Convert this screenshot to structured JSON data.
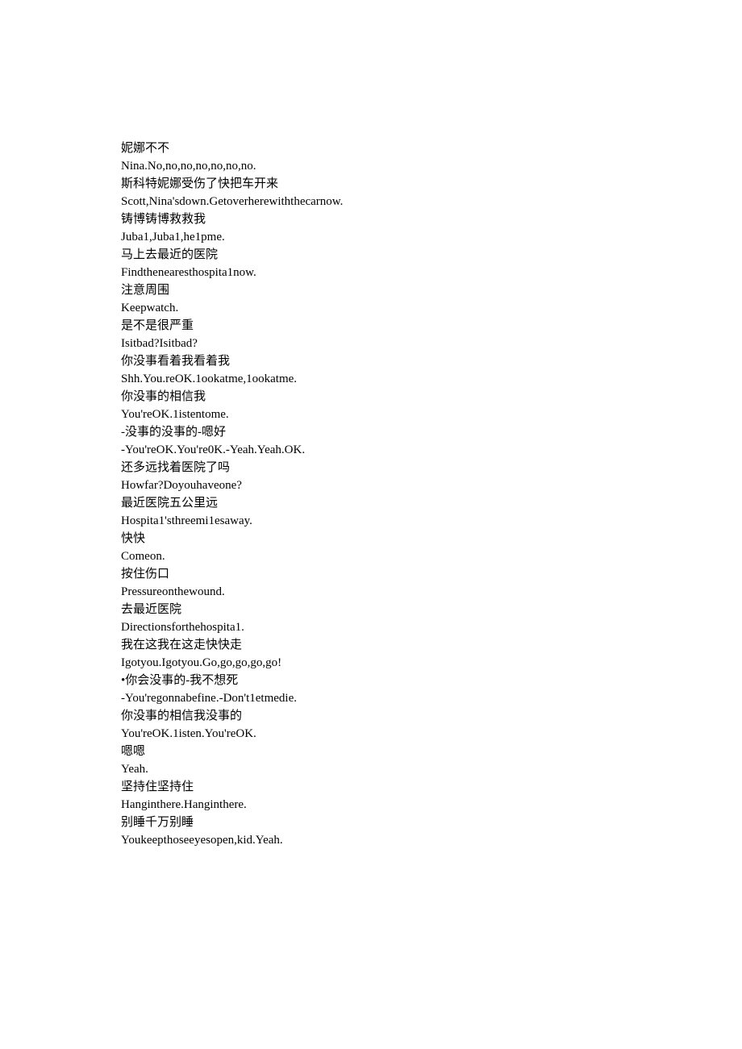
{
  "lines": [
    "妮娜不不",
    "Nina.No,no,no,no,no,no,no.",
    "斯科特妮娜受伤了快把车开来",
    "Scott,Nina'sdown.Getoverherewiththecarnow.",
    "铸博铸博救救我",
    "Juba1,Juba1,he1pme.",
    "马上去最近的医院",
    "Findthenearesthospita1now.",
    "注意周围",
    "Keepwatch.",
    "是不是很严重",
    "Isitbad?Isitbad?",
    "你没事看着我看着我",
    "Shh.You.reOK.1ookatme,1ookatme.",
    "你没事的相信我",
    "You'reOK.1istentome.",
    "-没事的没事的-嗯好",
    "-You'reOK.You're0K.-Yeah.Yeah.OK.",
    "还多远找着医院了吗",
    "Howfar?Doyouhaveone?",
    "最近医院五公里远",
    "Hospita1'sthreemi1esaway.",
    "快快",
    "Comeon.",
    "按住伤口",
    "Pressureonthewound.",
    "去最近医院",
    "Directionsforthehospita1.",
    "我在这我在这走快快走",
    "Igotyou.Igotyou.Go,go,go,go,go!",
    "•你会没事的-我不想死",
    "-You'regonnabefine.-Don't1etmedie.",
    "你没事的相信我没事的",
    "You'reOK.1isten.You'reOK.",
    "嗯嗯",
    "Yeah.",
    "坚持住坚持住",
    "Hanginthere.Hanginthere.",
    "别睡千万别睡",
    "Youkeepthoseeyesopen,kid.Yeah."
  ]
}
